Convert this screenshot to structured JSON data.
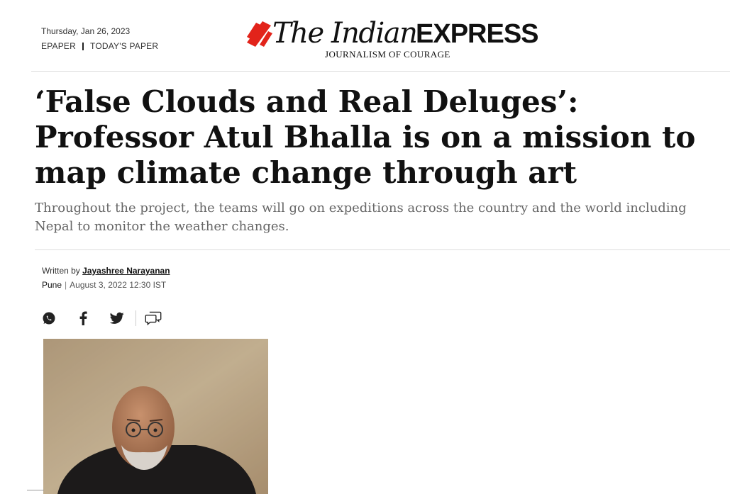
{
  "header": {
    "date": "Thursday, Jan 26, 2023",
    "links": [
      "EPAPER",
      "TODAY'S PAPER"
    ],
    "logo": {
      "part1": "The Indian",
      "part2": "EXPRESS",
      "tagline": "JOURNALISM OF COURAGE",
      "brand_color": "#e2231a"
    }
  },
  "article": {
    "headline": "‘False Clouds and Real Deluges’: Professor Atul Bhalla is on a mission to map climate change through art",
    "subhead": "Throughout the project, the teams will go on expeditions across the country and the world including Nepal to monitor the weather changes.",
    "byline_prefix": "Written by",
    "author": "Jayashree Narayanan",
    "city": "Pune",
    "published": "August 3, 2022 12:30 IST"
  },
  "share": {
    "icons": [
      "whatsapp-icon",
      "facebook-icon",
      "twitter-icon",
      "comments-icon"
    ]
  },
  "image": {
    "description_icon": "portrait-photo"
  }
}
